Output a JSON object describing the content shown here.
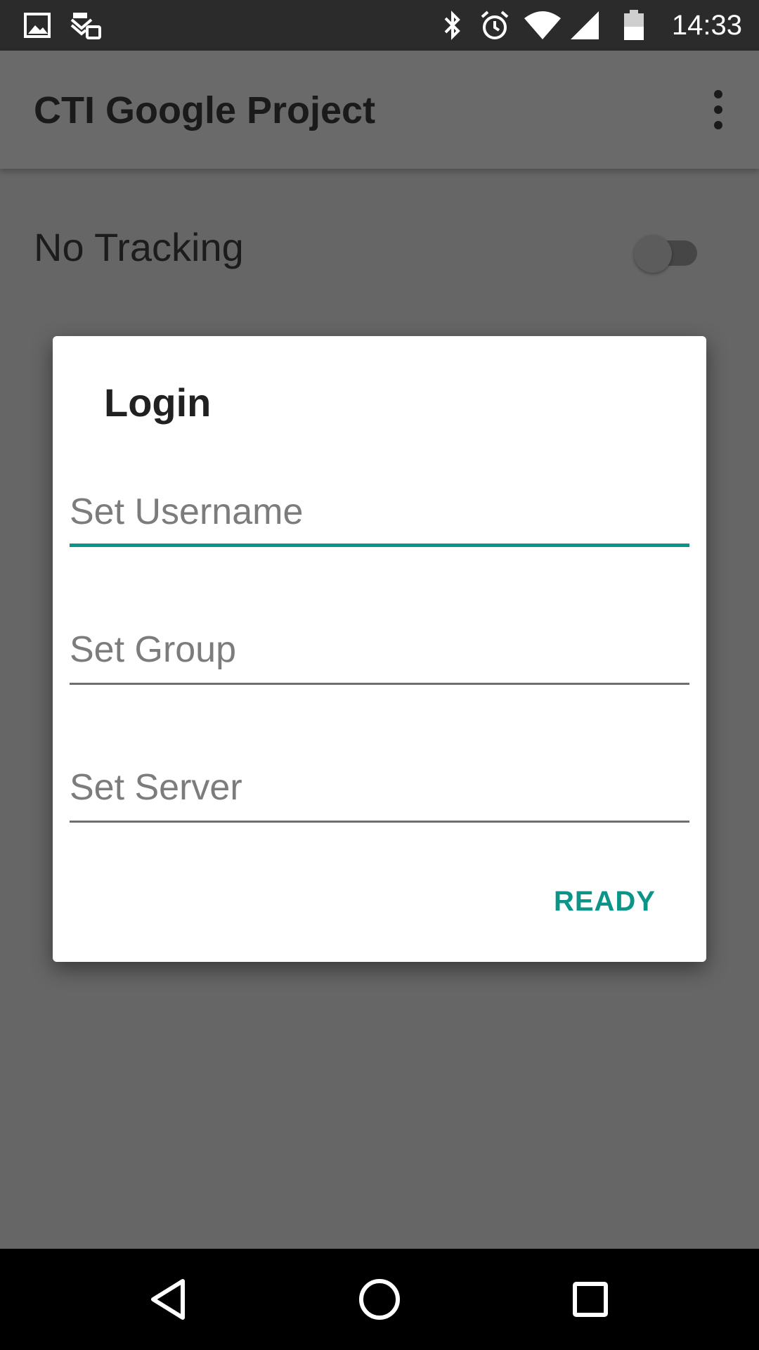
{
  "status_bar": {
    "time": "14:33",
    "icons": [
      "image-icon",
      "sync-icon",
      "bluetooth-icon",
      "alarm-icon",
      "wifi-icon",
      "signal-icon",
      "battery-icon"
    ]
  },
  "app_bar": {
    "title": "CTI Google Project",
    "menu_icon": "overflow-menu-icon"
  },
  "tracking": {
    "label": "No Tracking",
    "enabled": false
  },
  "dialog": {
    "title": "Login",
    "username_placeholder": "Set Username",
    "username_value": "",
    "group_placeholder": "Set Group",
    "group_value": "",
    "server_placeholder": "Set Server",
    "server_value": "",
    "ready_label": "READY"
  },
  "colors": {
    "accent": "#0b9488",
    "scrim_background": "#666666",
    "status_bar": "#2b2b2b",
    "nav_bar": "#000000"
  },
  "nav_bar": {
    "icons": [
      "back-icon",
      "home-icon",
      "recents-icon"
    ]
  }
}
